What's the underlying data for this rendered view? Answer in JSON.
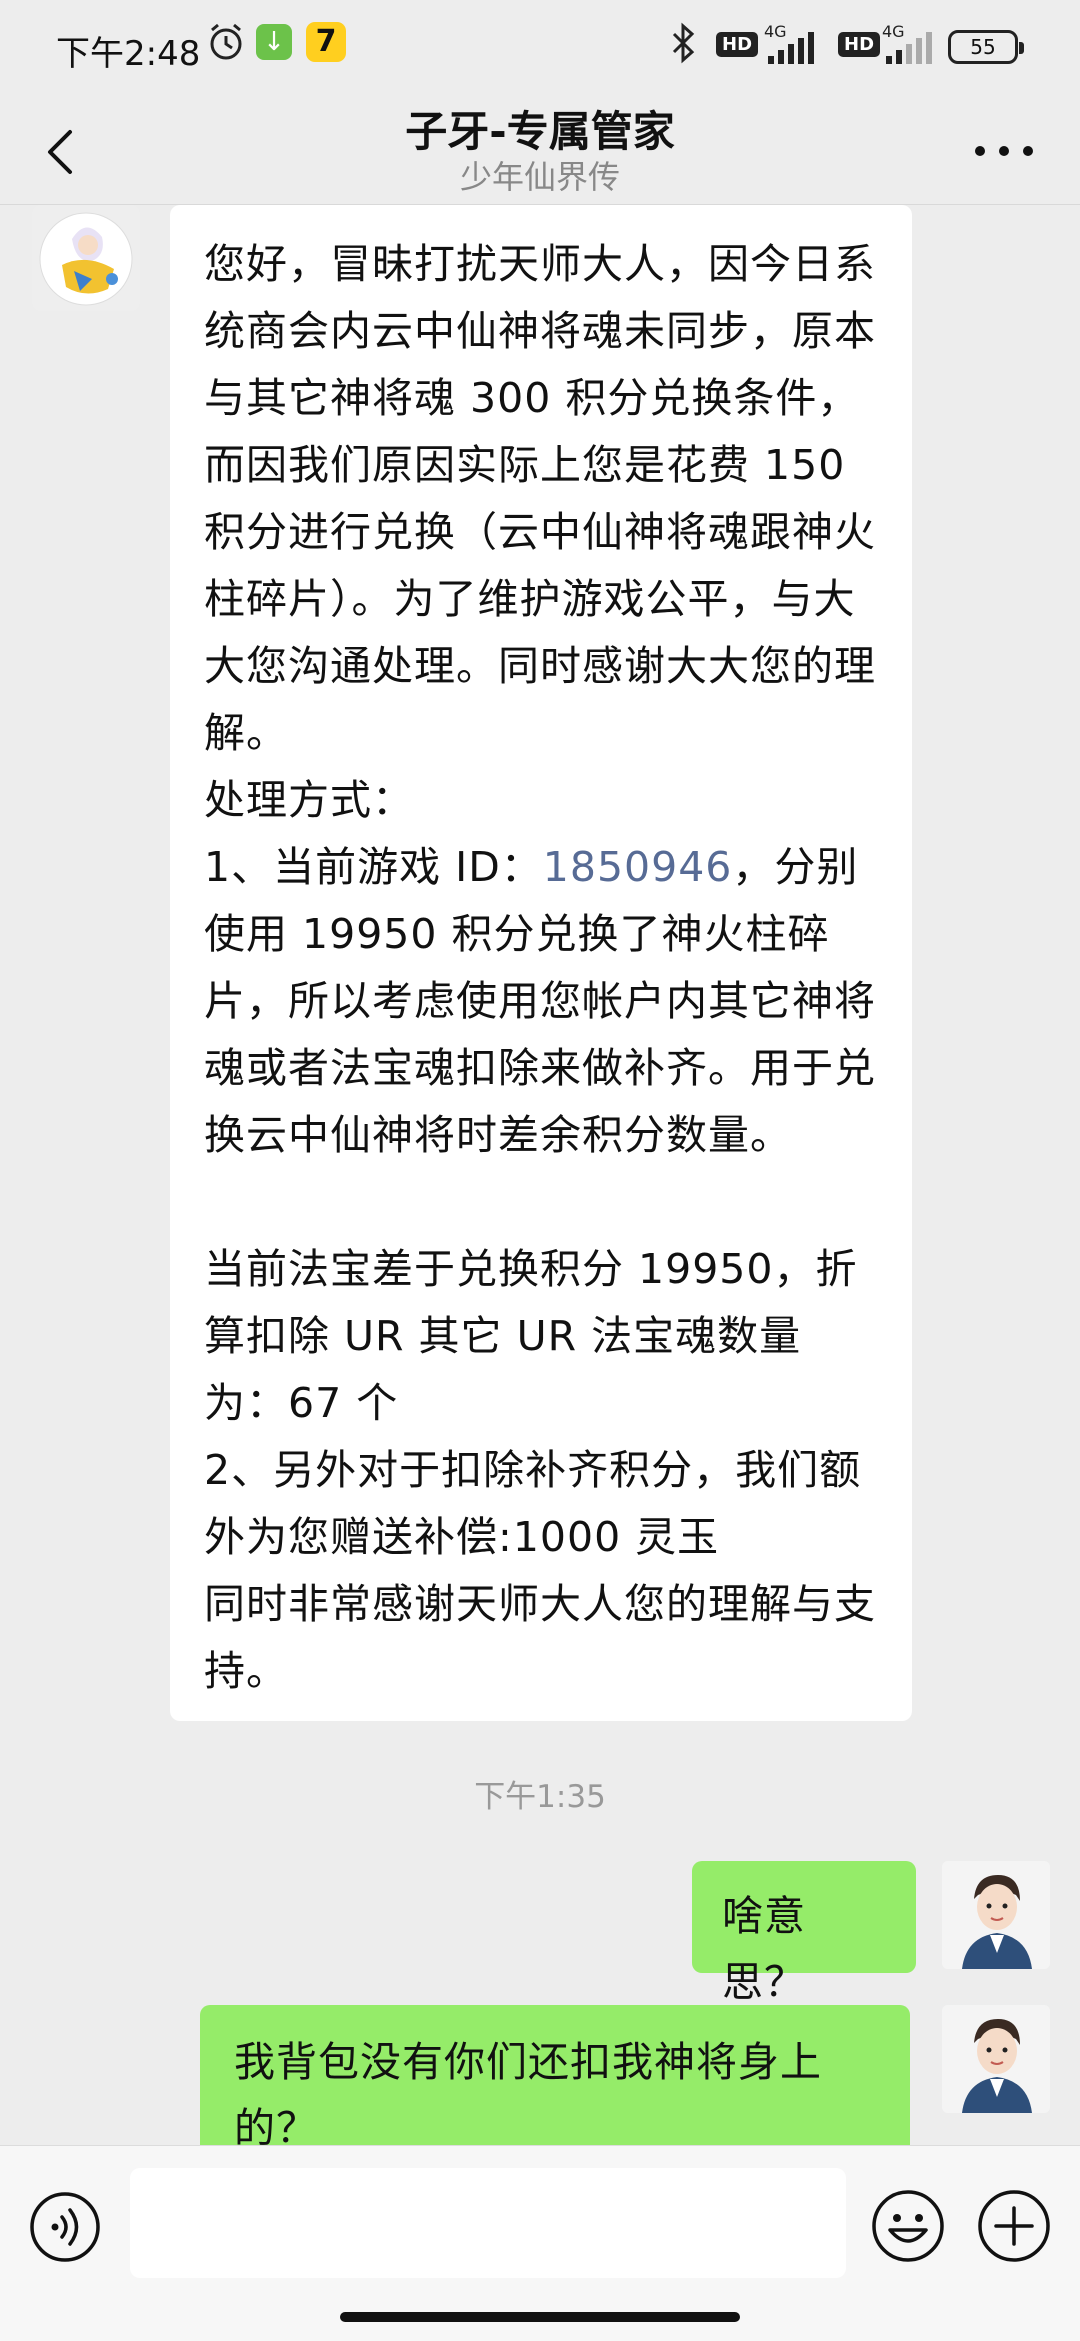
{
  "status_bar": {
    "time": "下午2:48",
    "hd1": "HD",
    "net1": "4G",
    "hd2": "HD",
    "net2": "4G",
    "battery": "55"
  },
  "header": {
    "title": "子牙-专属管家",
    "subtitle": "少年仙界传"
  },
  "messages": {
    "incoming": {
      "p1": "您好，冒昧打扰天师大人，因今日系统商会内云中仙神将魂未同步，原本与其它神将魂 300 积分兑换条件，而因我们原因实际上您是花费 150 积分进行兑换（云中仙神将魂跟神火柱碎片）。为了维护游戏公平，与大大您沟通处理。同时感谢大大您的理解。",
      "p2": "处理方式：",
      "p3_prefix": "1、当前游戏 ID：",
      "p3_id": "1850946",
      "p3_suffix": "，分别使用 19950 积分兑换了神火柱碎片，所以考虑使用您帐户内其它神将魂或者法宝魂扣除来做补齐。用于兑换云中仙神将时差余积分数量。",
      "p4": "当前法宝差于兑换积分 19950，折算扣除 UR 其它 UR 法宝魂数量为：67 个",
      "p5": "2、另外对于扣除补齐积分，我们额外为您赠送补偿:1000 灵玉",
      "p6": "同时非常感谢天师大人您的理解与支持。"
    },
    "timestamp": "下午1:35",
    "outgoing_1": "啥意思？",
    "outgoing_2": "我背包没有你们还扣我神将身上的？"
  },
  "colors": {
    "sent_bubble": "#95ec69",
    "link": "#576b95",
    "background": "#ededed"
  }
}
